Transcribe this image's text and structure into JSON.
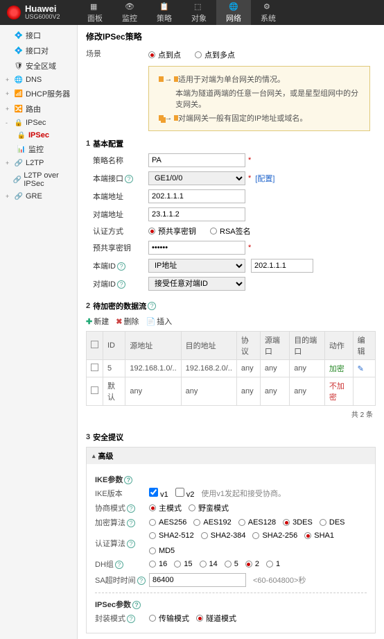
{
  "header": {
    "brand": "Huawei",
    "model": "USG6000V2",
    "nav": [
      "面板",
      "监控",
      "策略",
      "对象",
      "网络",
      "系统"
    ],
    "active_nav": 4
  },
  "sidebar": {
    "items": [
      {
        "label": "接口",
        "icon": "💠"
      },
      {
        "label": "接口对",
        "icon": "💠"
      },
      {
        "label": "安全区域",
        "icon": "🛡"
      },
      {
        "label": "DNS",
        "icon": "🌐",
        "expand": "+"
      },
      {
        "label": "DHCP服务器",
        "icon": "📶",
        "expand": "+"
      },
      {
        "label": "路由",
        "icon": "🔀",
        "expand": "+"
      },
      {
        "label": "IPSec",
        "icon": "🔒",
        "expand": "-",
        "children": [
          {
            "label": "IPSec",
            "icon": "🔒",
            "active": true
          },
          {
            "label": "监控",
            "icon": "📊"
          }
        ]
      },
      {
        "label": "L2TP",
        "icon": "🔗",
        "expand": "+"
      },
      {
        "label": "L2TP over IPSec",
        "icon": "🔗"
      },
      {
        "label": "GRE",
        "icon": "🔗",
        "expand": "+"
      }
    ]
  },
  "page": {
    "title": "修改IPSec策略",
    "scene_label": "场景",
    "scene_opts": [
      "点到点",
      "点到多点"
    ],
    "hints": [
      "适用于对端为单台网关的情况。",
      "本端为隧道两端的任意一台网关，或是星型组网中的分支网关。",
      "对端网关一般有固定的IP地址或域名。"
    ],
    "s1": {
      "num": "1",
      "title": "基本配置",
      "policy_name_label": "策略名称",
      "policy_name": "PA",
      "local_if_label": "本端接口",
      "local_if": "GE1/0/0",
      "config_link": "[配置]",
      "local_addr_label": "本端地址",
      "local_addr": "202.1.1.1",
      "peer_addr_label": "对端地址",
      "peer_addr": "23.1.1.2",
      "auth_label": "认证方式",
      "auth_opts": [
        "预共享密钥",
        "RSA签名"
      ],
      "psk_label": "预共享密钥",
      "psk": "••••••",
      "local_id_label": "本端ID",
      "local_id_sel": "IP地址",
      "local_id_val": "202.1.1.1",
      "peer_id_label": "对端ID",
      "peer_id_sel": "接受任意对端ID"
    },
    "s2": {
      "num": "2",
      "title": "待加密的数据流",
      "tools": [
        "新建",
        "删除",
        "插入"
      ],
      "cols": [
        "ID",
        "源地址",
        "目的地址",
        "协议",
        "源端口",
        "目的端口",
        "动作",
        "编辑"
      ],
      "rows": [
        {
          "id": "5",
          "src": "192.168.1.0/..",
          "dst": "192.168.2.0/..",
          "proto": "any",
          "sp": "any",
          "dp": "any",
          "action": "加密",
          "cls": "green",
          "edit": true
        },
        {
          "id": "默认",
          "src": "any",
          "dst": "any",
          "proto": "any",
          "sp": "any",
          "dp": "any",
          "action": "不加密",
          "cls": "red",
          "edit": false
        }
      ],
      "pager": "共 2 条"
    },
    "s3": {
      "num": "3",
      "title": "安全提议",
      "adv": "高级",
      "ike_title": "IKE参数",
      "ike_ver_label": "IKE版本",
      "ike_ver_opts": [
        "v1",
        "v2"
      ],
      "ike_hint": "使用v1发起和接受协商。",
      "neg_label": "协商模式",
      "neg_opts": [
        "主模式",
        "野蛮模式"
      ],
      "enc_label": "加密算法",
      "enc_opts": [
        "AES256",
        "AES192",
        "AES128",
        "3DES",
        "DES"
      ],
      "auth_alg_label": "认证算法",
      "auth_opts": [
        "SHA2-512",
        "SHA2-384",
        "SHA2-256",
        "SHA1",
        "MD5"
      ],
      "dh_label": "DH组",
      "dh_opts": [
        "16",
        "15",
        "14",
        "5",
        "2",
        "1"
      ],
      "sa_label": "SA超时时间",
      "sa_val": "86400",
      "sa_hint": "<60-604800>秒",
      "ipsec_title": "IPSec参数",
      "encap_label": "封装模式",
      "encap_opts": [
        "传输模式",
        "隧道模式"
      ]
    }
  }
}
